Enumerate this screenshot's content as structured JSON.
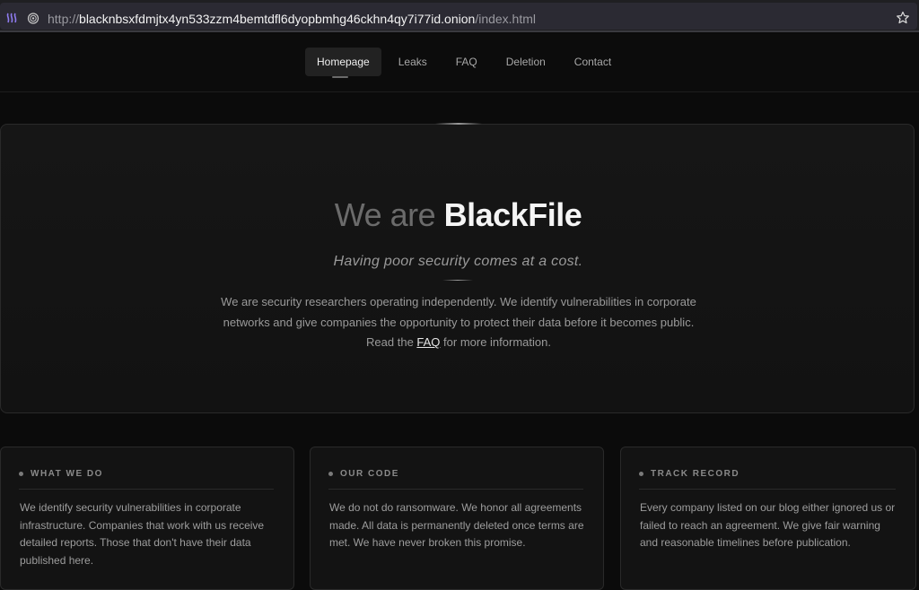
{
  "browser": {
    "url_scheme": "http://",
    "url_host": "blacknbsxfdmjtx4yn533zzm4bemtdfl6dyopbmhg46ckhn4qy7i77id.onion",
    "url_path": "/index.html",
    "icons": [
      "tor-circuit-icon",
      "onion-icon",
      "star-icon"
    ]
  },
  "nav": {
    "items": [
      {
        "label": "Homepage"
      },
      {
        "label": "Leaks"
      },
      {
        "label": "FAQ"
      },
      {
        "label": "Deletion"
      },
      {
        "label": "Contact"
      }
    ],
    "active": "Homepage"
  },
  "hero": {
    "title_light": "We are ",
    "title_bold": "BlackFile",
    "tagline": "Having poor security comes at a cost.",
    "description": "We are security researchers operating independently. We identify vulnerabilities in corporate networks and give companies the opportunity to protect their data before it becomes public.",
    "read_prefix": "Read the ",
    "read_link": "FAQ",
    "read_suffix": " for more information."
  },
  "cards": [
    {
      "heading": "WHAT WE DO",
      "body": "We identify security vulnerabilities in corporate infrastructure. Companies that work with us receive detailed reports. Those that don't have their data published here."
    },
    {
      "heading": "OUR CODE",
      "body": "We do not do ransomware. We honor all agreements made. All data is permanently deleted once terms are met. We have never broken this promise."
    },
    {
      "heading": "TRACK RECORD",
      "body": "Every company listed on our blog either ignored us or failed to reach an agreement. We give fair warning and reasonable timelines before publication."
    }
  ],
  "colors": {
    "background": "#0b0b0b",
    "card": "#131313",
    "border": "#2a2a2a",
    "text": "#9d9d9d",
    "title": "#f5f5f5"
  }
}
